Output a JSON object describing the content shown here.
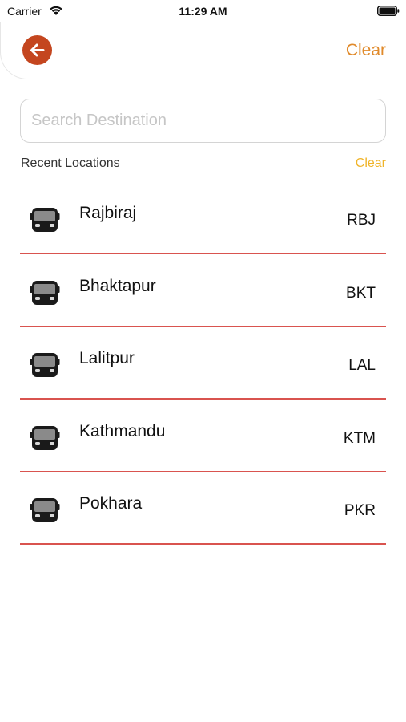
{
  "status_bar": {
    "carrier": "Carrier",
    "time": "11:29 AM"
  },
  "header": {
    "clear_label": "Clear",
    "accent_color": "#c4461f",
    "clear_color": "#e08a2b"
  },
  "search": {
    "placeholder": "Search Destination",
    "value": ""
  },
  "recent": {
    "title": "Recent Locations",
    "clear_label": "Clear",
    "clear_color": "#f0b429"
  },
  "locations": [
    {
      "name": "Rajbiraj",
      "code": "RBJ",
      "icon": "bus-icon"
    },
    {
      "name": "Bhaktapur",
      "code": "BKT",
      "icon": "bus-icon"
    },
    {
      "name": "Lalitpur",
      "code": "LAL",
      "icon": "bus-icon"
    },
    {
      "name": "Kathmandu",
      "code": "KTM",
      "icon": "bus-icon"
    },
    {
      "name": "Pokhara",
      "code": "PKR",
      "icon": "bus-icon"
    }
  ],
  "divider_color": "#d9534f"
}
